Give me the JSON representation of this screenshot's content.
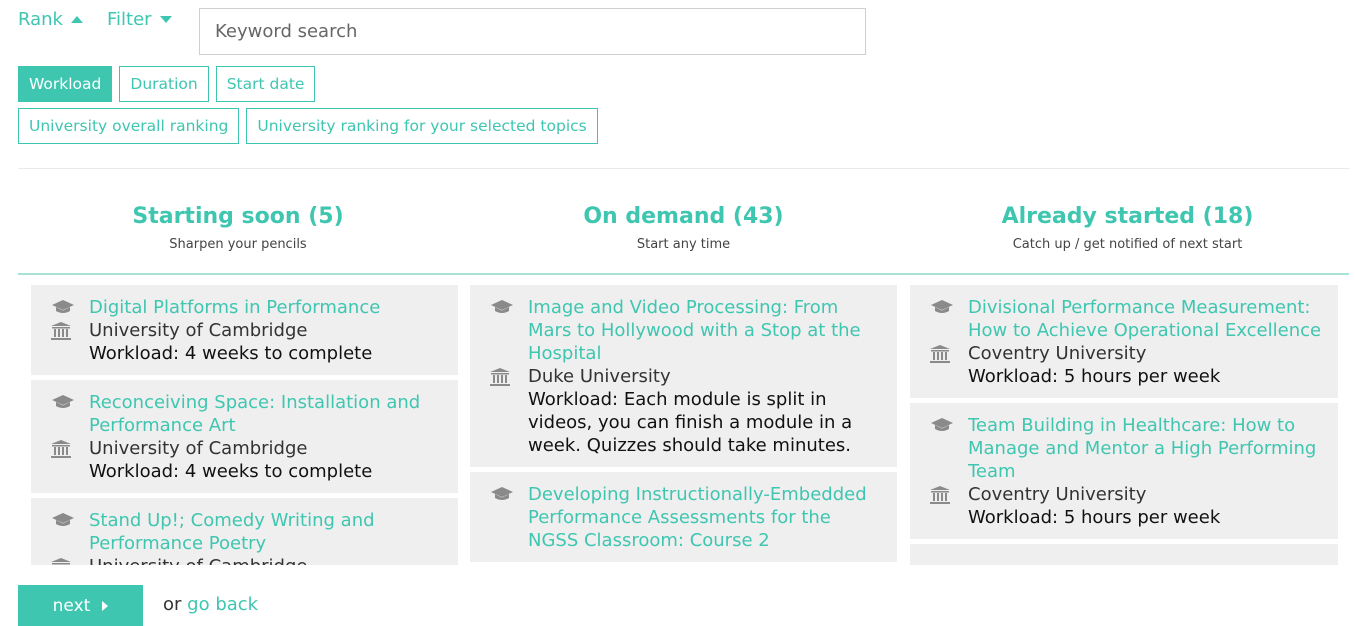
{
  "toolbar": {
    "rank_label": "Rank",
    "filter_label": "Filter",
    "search_placeholder": "Keyword search"
  },
  "rank_options": {
    "row1": [
      "Workload",
      "Duration",
      "Start date"
    ],
    "row2": [
      "University overall ranking",
      "University ranking for your selected topics"
    ],
    "active": "Workload"
  },
  "columns": [
    {
      "title": "Starting soon (5)",
      "subtitle": "Sharpen your pencils",
      "courses": [
        {
          "title": "Digital Platforms in Performance",
          "university": "University of Cambridge",
          "workload": "Workload: 4 weeks to complete"
        },
        {
          "title": "Reconceiving Space: Installation and Performance Art",
          "university": "University of Cambridge",
          "workload": "Workload: 4 weeks to complete"
        },
        {
          "title": "Stand Up!; Comedy Writing and Performance Poetry",
          "university": "University of Cambridge",
          "workload": ""
        }
      ]
    },
    {
      "title": "On demand (43)",
      "subtitle": "Start any time",
      "courses": [
        {
          "title": "Image and Video Processing: From Mars to Hollywood with a Stop at the Hospital",
          "university": "Duke University",
          "workload": "Workload: Each module is split in videos, you can finish a module in a week. Quizzes should take minutes."
        },
        {
          "title": "Developing Instructionally-Embedded Performance Assessments for the NGSS Classroom: Course 2",
          "university": "",
          "workload": ""
        }
      ]
    },
    {
      "title": "Already started (18)",
      "subtitle": "Catch up / get notified of next start",
      "courses": [
        {
          "title": "Divisional Performance Measurement: How to Achieve Operational Excellence",
          "university": "Coventry University",
          "workload": "Workload: 5 hours per week"
        },
        {
          "title": "Team Building in Healthcare: How to Manage and Mentor a High Performing Team",
          "university": "Coventry University",
          "workload": "Workload: 5 hours per week"
        }
      ]
    }
  ],
  "footer": {
    "next_label": "next",
    "or_text": "or",
    "back_label": "go back"
  },
  "colors": {
    "accent": "#3fc6b0",
    "card_bg": "#efefef"
  },
  "icons": {
    "course": "graduation-cap-icon",
    "university": "university-building-icon"
  }
}
